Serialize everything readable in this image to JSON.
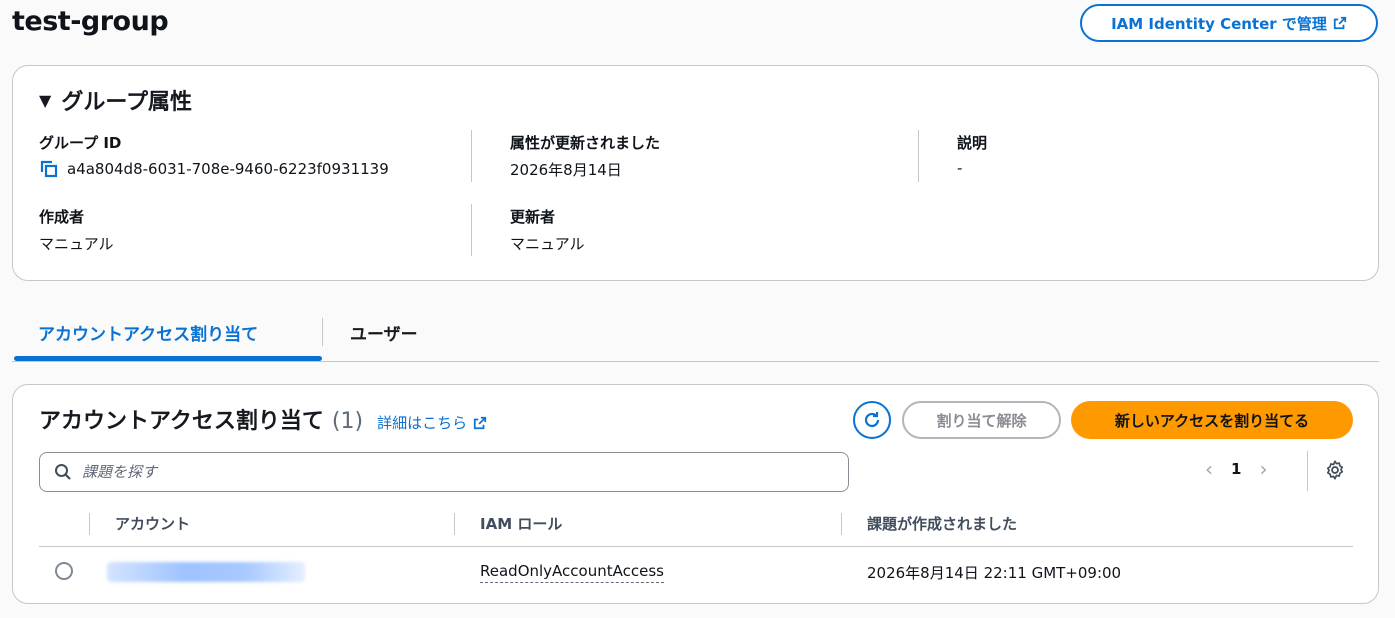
{
  "page": {
    "title": "test-group",
    "manage_button": "IAM Identity Center で管理"
  },
  "group_properties": {
    "header": "グループ属性",
    "group_id_label": "グループ ID",
    "group_id_value": "a4a804d8-6031-708e-9460-6223f0931139",
    "updated_label": "属性が更新されました",
    "updated_value": "2026年8月14日",
    "description_label": "説明",
    "description_value": "-",
    "creator_label": "作成者",
    "creator_value": "マニュアル",
    "updater_label": "更新者",
    "updater_value": "マニュアル"
  },
  "tabs": [
    {
      "label": "アカウントアクセス割り当て",
      "active": true
    },
    {
      "label": "ユーザー",
      "active": false
    }
  ],
  "assignments": {
    "title": "アカウントアクセス割り当て",
    "count": "(1)",
    "info_link": "詳細はこちら",
    "unassign_button": "割り当て解除",
    "assign_button": "新しいアクセスを割り当てる",
    "search_placeholder": "課題を探す",
    "page_number": "1",
    "columns": [
      "アカウント",
      "IAM ロール",
      "課題が作成されました"
    ],
    "rows": [
      {
        "account": "",
        "role": "ReadOnlyAccountAccess",
        "created": "2026年8月14日 22:11 GMT+09:00"
      }
    ]
  },
  "colors": {
    "accent": "#0972d3",
    "primary_button": "#ff9900"
  }
}
